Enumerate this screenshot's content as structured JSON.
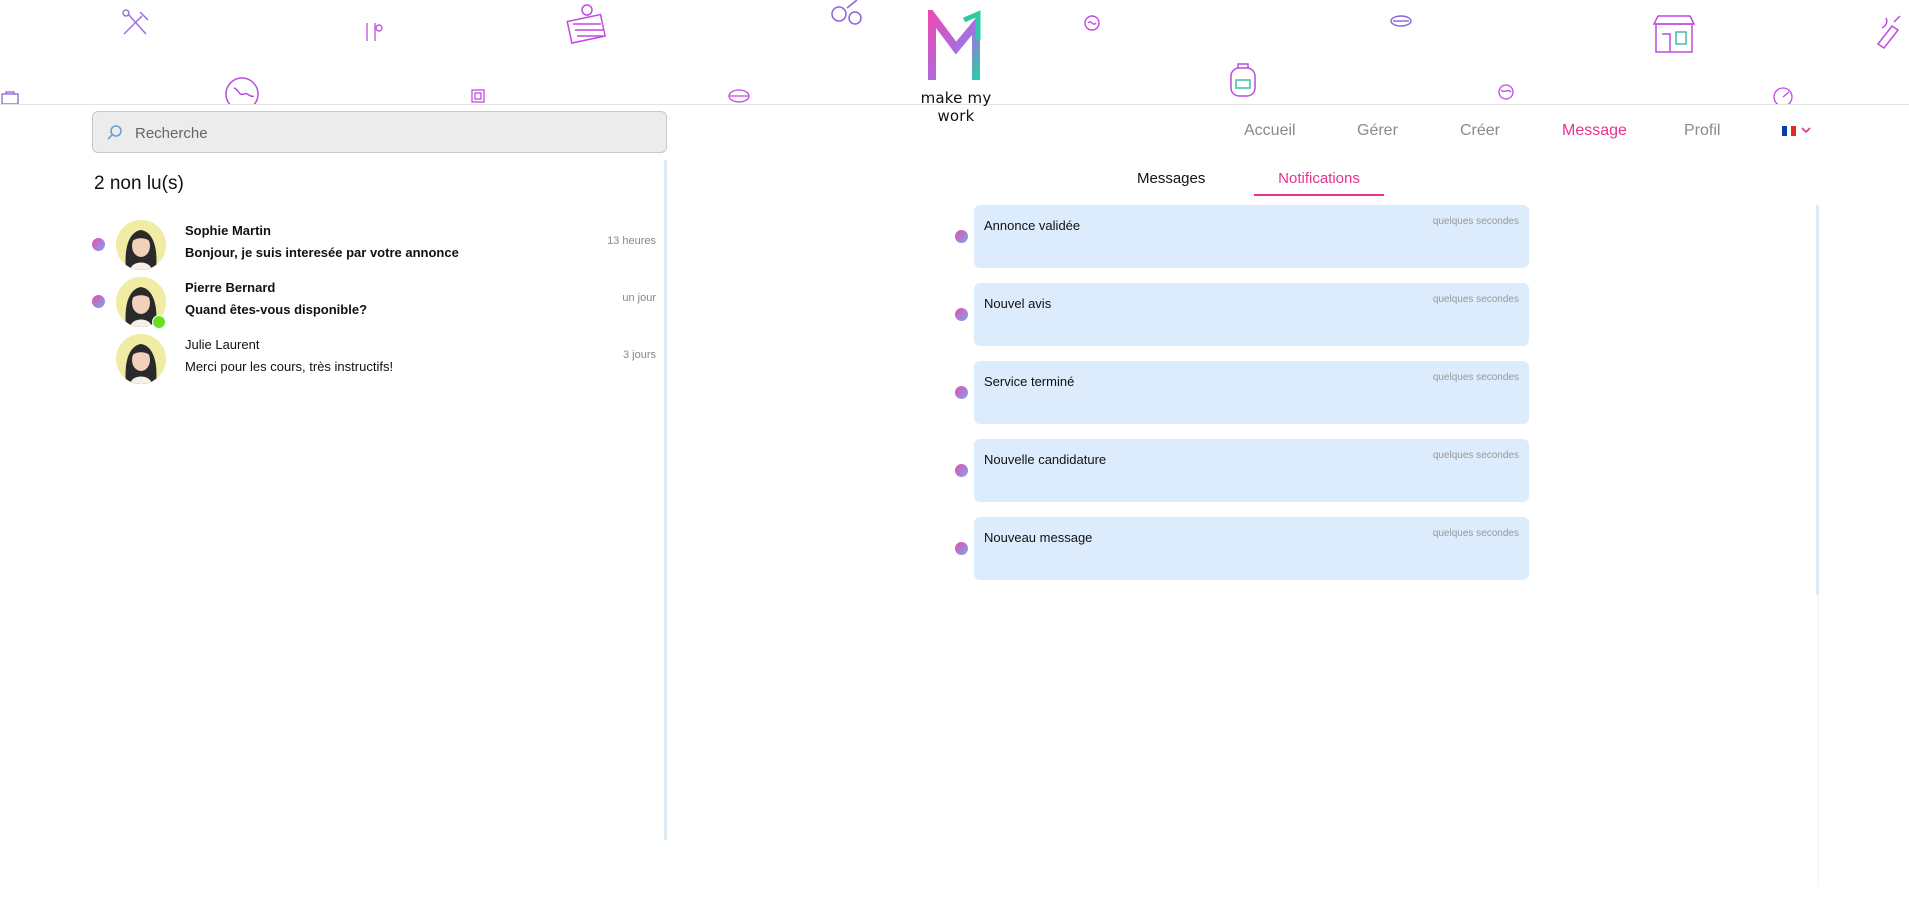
{
  "brand": {
    "name": "make my work"
  },
  "search": {
    "placeholder": "Recherche"
  },
  "nav": {
    "items": [
      {
        "label": "Accueil",
        "active": false
      },
      {
        "label": "Gérer",
        "active": false
      },
      {
        "label": "Créer",
        "active": false
      },
      {
        "label": "Message",
        "active": true
      },
      {
        "label": "Profil",
        "active": false
      }
    ],
    "language": "fr"
  },
  "conversations": {
    "unread_label": "2 non lu(s)",
    "items": [
      {
        "name": "Sophie Martin",
        "message": "Bonjour, je suis interesée par votre annonce",
        "time": "13 heures",
        "unread": true,
        "online": false
      },
      {
        "name": "Pierre Bernard",
        "message": "Quand êtes-vous disponible?",
        "time": "un jour",
        "unread": true,
        "online": true
      },
      {
        "name": "Julie Laurent",
        "message": "Merci pour les cours, très instructifs!",
        "time": "3 jours",
        "unread": false,
        "online": false
      }
    ]
  },
  "tabs": {
    "messages": "Messages",
    "notifications": "Notifications",
    "active": "notifications"
  },
  "notifications": [
    {
      "title": "Annonce validée",
      "time": "quelques secondes"
    },
    {
      "title": "Nouvel avis",
      "time": "quelques secondes"
    },
    {
      "title": "Service terminé",
      "time": "quelques secondes"
    },
    {
      "title": "Nouvelle candidature",
      "time": "quelques secondes"
    },
    {
      "title": "Nouveau message",
      "time": "quelques secondes"
    }
  ],
  "colors": {
    "accent": "#e5338f",
    "notification_bg": "#dcecfc",
    "online": "#66e01e",
    "search_bg": "#ececec"
  }
}
